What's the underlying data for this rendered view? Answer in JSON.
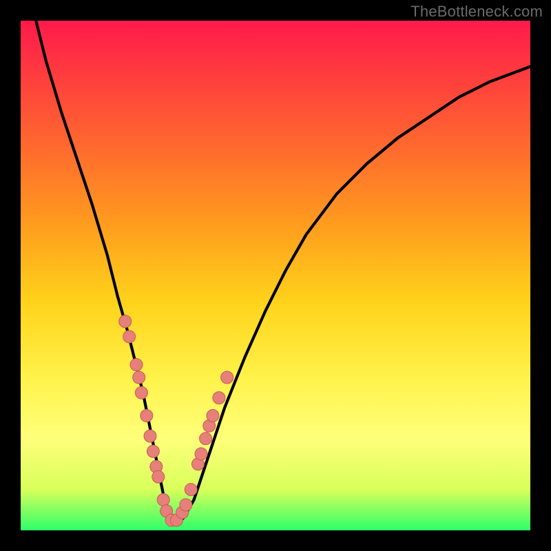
{
  "watermark": "TheBottleneck.com",
  "colors": {
    "frame": "#000000",
    "gradient_stops": [
      "#ff1a4b",
      "#ff3a3f",
      "#ff6a2e",
      "#ff9c1e",
      "#ffd21a",
      "#fff24a",
      "#ffff7a",
      "#d8ff5a",
      "#2eff6a"
    ],
    "curve": "#000000",
    "markers_fill": "#e77f7a",
    "markers_stroke": "#c45b56"
  },
  "chart_data": {
    "type": "line",
    "title": "",
    "xlabel": "",
    "ylabel": "",
    "xlim": [
      0,
      100
    ],
    "ylim": [
      0,
      100
    ],
    "grid": false,
    "legend": false,
    "series": [
      {
        "name": "bottleneck-curve",
        "x": [
          3,
          5,
          8,
          11,
          14,
          17,
          19,
          21,
          22.5,
          24,
          25,
          26,
          27,
          28,
          29,
          30,
          31,
          32,
          34,
          36,
          38,
          40,
          44,
          48,
          52,
          56,
          62,
          68,
          74,
          80,
          86,
          92,
          100
        ],
        "y": [
          100,
          92,
          82,
          73,
          64,
          54,
          46,
          39,
          33,
          27,
          22,
          17,
          12,
          7,
          4,
          1.5,
          1.5,
          2.5,
          6,
          12,
          18,
          24,
          34,
          43,
          51,
          58,
          66,
          72,
          77,
          81,
          85,
          88,
          91
        ]
      }
    ],
    "markers": [
      {
        "x": 20.5,
        "y": 41
      },
      {
        "x": 21.3,
        "y": 38
      },
      {
        "x": 22.7,
        "y": 32.5
      },
      {
        "x": 23.2,
        "y": 30
      },
      {
        "x": 23.7,
        "y": 27
      },
      {
        "x": 24.7,
        "y": 22.5
      },
      {
        "x": 25.4,
        "y": 18.5
      },
      {
        "x": 26.0,
        "y": 15.5
      },
      {
        "x": 26.6,
        "y": 12.5
      },
      {
        "x": 27.0,
        "y": 10.5
      },
      {
        "x": 28.0,
        "y": 6
      },
      {
        "x": 28.6,
        "y": 3.8
      },
      {
        "x": 29.6,
        "y": 2
      },
      {
        "x": 30.6,
        "y": 2
      },
      {
        "x": 31.7,
        "y": 3.5
      },
      {
        "x": 32.4,
        "y": 5
      },
      {
        "x": 33.4,
        "y": 8
      },
      {
        "x": 34.8,
        "y": 13
      },
      {
        "x": 35.4,
        "y": 15
      },
      {
        "x": 36.3,
        "y": 18
      },
      {
        "x": 37.0,
        "y": 20.5
      },
      {
        "x": 37.7,
        "y": 22.5
      },
      {
        "x": 38.9,
        "y": 26
      },
      {
        "x": 40.5,
        "y": 30
      }
    ]
  }
}
